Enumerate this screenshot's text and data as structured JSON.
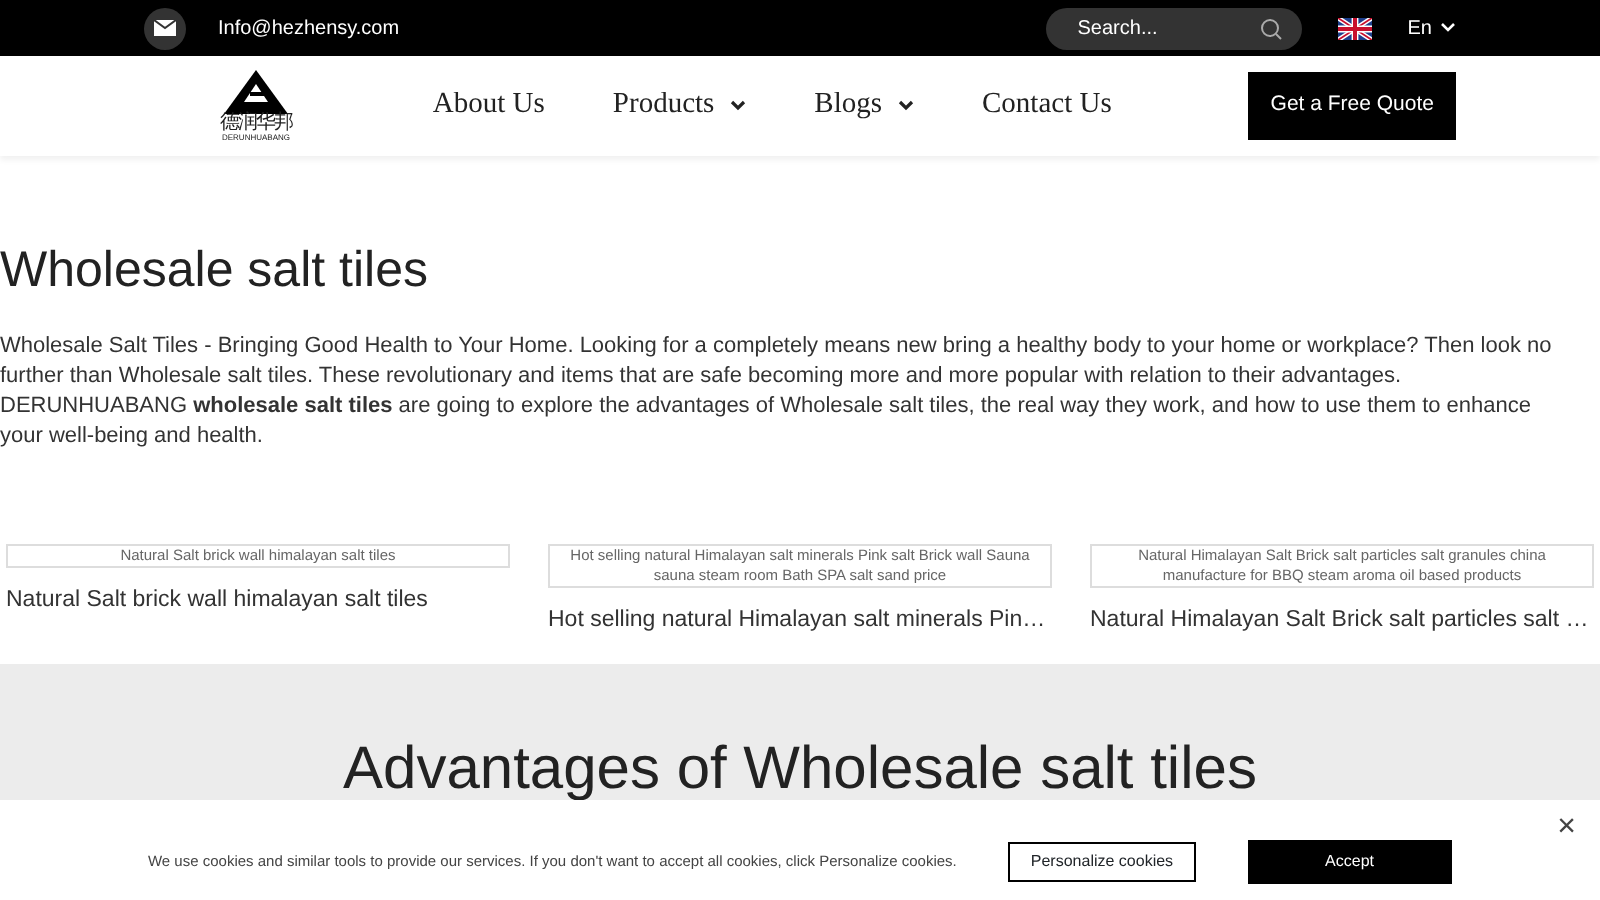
{
  "top_bar": {
    "email": "Info@hezhensy.com",
    "search": {
      "placeholder": "Search..."
    },
    "language": "En"
  },
  "header": {
    "logo": {
      "chinese": "德润华邦",
      "latin": "DERUNHUABANG"
    },
    "nav": [
      {
        "label": "About Us",
        "dropdown": false
      },
      {
        "label": "Products",
        "dropdown": true
      },
      {
        "label": "Blogs",
        "dropdown": true
      },
      {
        "label": "Contact Us",
        "dropdown": false
      }
    ],
    "quote_button": "Get a Free Quote"
  },
  "intro": {
    "title": "Wholesale salt tiles",
    "text": "Wholesale Salt Tiles - Bringing Good Health to Your Home. Looking for a completely means new bring a healthy body to your home or workplace? Then look no further than Wholesale salt tiles. These revolutionary and items that are safe becoming more and more popular with relation to their advantages. DERUNHUABANG **wholesale salt tiles** are going to explore the advantages of Wholesale salt tiles, the real way they work, and how to use them to enhance your well-being and health."
  },
  "products": [
    {
      "image_alt": "Natural Salt brick wall himalayan salt tiles",
      "title": "Natural Salt brick wall himalayan salt tiles"
    },
    {
      "image_alt": "Hot selling natural Himalayan salt minerals Pink salt Brick wall Sauna sauna steam room Bath SPA salt sand price",
      "title": "Hot selling natural Himalayan salt minerals Pin…"
    },
    {
      "image_alt": "Natural Himalayan Salt Brick salt particles salt granules china manufacture for BBQ steam aroma oil based products",
      "title": "Natural Himalayan Salt Brick salt particles salt …"
    }
  ],
  "advantages": {
    "title": "Advantages of Wholesale salt tiles"
  },
  "cookie_banner": {
    "text": "We use cookies and similar tools to provide our services. If you don't want to accept all cookies, click Personalize cookies.",
    "personalize_button": "Personalize cookies",
    "accept_button": "Accept",
    "close": "×"
  }
}
